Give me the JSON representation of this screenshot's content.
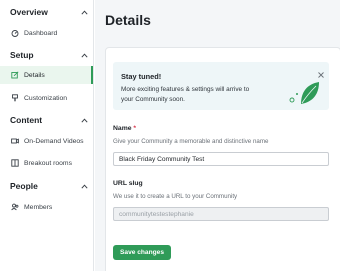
{
  "sidebar": {
    "sections": [
      {
        "title": "Overview",
        "items": [
          {
            "label": "Dashboard",
            "icon": "dashboard-icon"
          }
        ]
      },
      {
        "title": "Setup",
        "items": [
          {
            "label": "Details",
            "icon": "details-icon",
            "active": true
          },
          {
            "label": "Customization",
            "icon": "brush-icon"
          }
        ]
      },
      {
        "title": "Content",
        "items": [
          {
            "label": "On-Demand Videos",
            "icon": "video-icon"
          },
          {
            "label": "Breakout rooms",
            "icon": "rooms-icon"
          }
        ]
      },
      {
        "title": "People",
        "items": [
          {
            "label": "Members",
            "icon": "members-icon"
          }
        ]
      }
    ]
  },
  "main": {
    "title": "Details",
    "notice": {
      "title": "Stay tuned!",
      "body": "More exciting features & settings will arrive to your Community soon."
    },
    "form": {
      "name_label": "Name",
      "name_required": "*",
      "name_hint": "Give your Community a memorable and distinctive name",
      "name_value": "Black Friday Community Test",
      "slug_label": "URL slug",
      "slug_hint": "We use it to create a URL to your Community",
      "slug_value": "communitytestestephanie",
      "save_label": "Save changes"
    }
  },
  "colors": {
    "accent": "#2f9b58",
    "active_bg": "#eaf6ee",
    "notice_bg": "#eef6f8"
  }
}
